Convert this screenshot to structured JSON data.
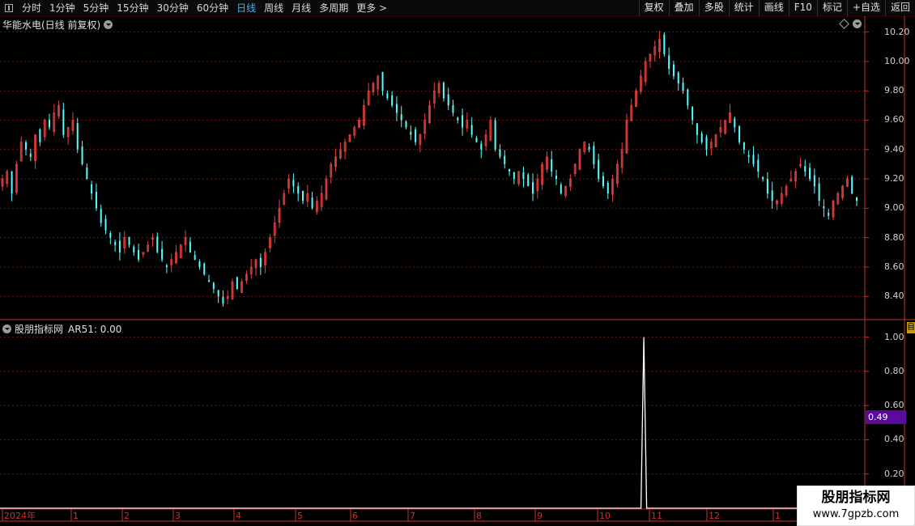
{
  "toolbar": {
    "periods": [
      "分时",
      "1分钟",
      "5分钟",
      "15分钟",
      "30分钟",
      "60分钟",
      "日线",
      "周线",
      "月线",
      "多周期",
      "更多 >"
    ],
    "active_period": "日线",
    "right_buttons": [
      "复权",
      "叠加",
      "多股",
      "统计",
      "画线",
      "F10",
      "标记",
      "+自选",
      "返回"
    ]
  },
  "main_panel": {
    "title": "华能水电(日线 前复权)",
    "y_ticks": [
      "10.20",
      "10.00",
      "9.80",
      "9.60",
      "9.40",
      "9.20",
      "9.00",
      "8.80",
      "8.60",
      "8.40"
    ]
  },
  "sub_panel": {
    "title": "股朋指标网",
    "indicator_label": "AR51: 0.00",
    "y_ticks": [
      "1.00",
      "0.80",
      "0.60",
      "0.40",
      "0.20"
    ],
    "cursor_value": "0.49"
  },
  "x_axis": {
    "labels": [
      "2024年",
      "1",
      "2",
      "3",
      "4",
      "5",
      "6",
      "7",
      "8",
      "9",
      "10",
      "11",
      "12",
      "1"
    ]
  },
  "side_column": {
    "corner": "自"
  },
  "watermark": {
    "line1": "股朋指标网",
    "line2": "www.7gpzb.com"
  },
  "colors": {
    "up": "#e8413c",
    "down": "#54ffff",
    "grid": "#7a1010",
    "active": "#3cb4ff",
    "cursor_box": "#5a0a9c"
  },
  "chart_data": [
    {
      "type": "candlestick",
      "title": "华能水电(日线 前复权)",
      "ylim": [
        8.28,
        10.22
      ],
      "y_ticks": [
        10.2,
        10.0,
        9.8,
        9.6,
        9.4,
        9.2,
        9.0,
        8.8,
        8.6,
        8.4
      ],
      "closes": [
        9.2,
        9.25,
        9.1,
        9.3,
        9.45,
        9.4,
        9.35,
        9.5,
        9.45,
        9.6,
        9.55,
        9.65,
        9.7,
        9.5,
        9.55,
        9.6,
        9.4,
        9.3,
        9.2,
        9.1,
        9.0,
        8.9,
        8.85,
        8.8,
        8.75,
        8.7,
        8.8,
        8.75,
        8.7,
        8.65,
        8.7,
        8.75,
        8.8,
        8.7,
        8.65,
        8.6,
        8.65,
        8.7,
        8.75,
        8.8,
        8.7,
        8.65,
        8.6,
        8.55,
        8.5,
        8.45,
        8.4,
        8.35,
        8.4,
        8.5,
        8.45,
        8.5,
        8.55,
        8.6,
        8.65,
        8.6,
        8.7,
        8.8,
        8.9,
        9.0,
        9.1,
        9.2,
        9.15,
        9.1,
        9.05,
        9.1,
        9.0,
        9.05,
        9.1,
        9.2,
        9.3,
        9.35,
        9.4,
        9.45,
        9.5,
        9.55,
        9.6,
        9.7,
        9.8,
        9.85,
        9.9,
        9.8,
        9.75,
        9.7,
        9.65,
        9.6,
        9.55,
        9.5,
        9.45,
        9.5,
        9.6,
        9.7,
        9.8,
        9.85,
        9.75,
        9.7,
        9.65,
        9.6,
        9.55,
        9.6,
        9.5,
        9.45,
        9.4,
        9.5,
        9.6,
        9.4,
        9.35,
        9.3,
        9.25,
        9.2,
        9.25,
        9.2,
        9.15,
        9.1,
        9.2,
        9.3,
        9.35,
        9.25,
        9.2,
        9.1,
        9.15,
        9.2,
        9.3,
        9.4,
        9.45,
        9.4,
        9.3,
        9.2,
        9.15,
        9.1,
        9.2,
        9.3,
        9.4,
        9.6,
        9.7,
        9.8,
        9.9,
        10.0,
        10.05,
        10.1,
        10.15,
        10.05,
        9.95,
        9.9,
        9.85,
        9.8,
        9.7,
        9.6,
        9.5,
        9.45,
        9.4,
        9.45,
        9.5,
        9.55,
        9.6,
        9.65,
        9.55,
        9.45,
        9.4,
        9.35,
        9.3,
        9.25,
        9.2,
        9.1,
        9.05,
        9.05,
        9.1,
        9.15,
        9.2,
        9.25,
        9.3,
        9.25,
        9.2,
        9.15,
        9.05,
        9.0,
        8.95,
        9.05,
        9.1,
        9.15,
        9.2,
        9.1,
        9.05
      ]
    },
    {
      "type": "line",
      "title": "股朋指标网",
      "series": [
        {
          "name": "AR51",
          "values": [
            0,
            0,
            0,
            0,
            0,
            0,
            0,
            0,
            0,
            0,
            0,
            0,
            0,
            0,
            0,
            0,
            0,
            0,
            0,
            0,
            0,
            0,
            0,
            0,
            0,
            0,
            0,
            0,
            0,
            0,
            0,
            0,
            0,
            0,
            0,
            0,
            0,
            0,
            0,
            0,
            0,
            0,
            0,
            0,
            0,
            0,
            0,
            0,
            0,
            0,
            0,
            0,
            0,
            0,
            0,
            0,
            0,
            0,
            0,
            0,
            0,
            0,
            0,
            0,
            0,
            0,
            0,
            0,
            0,
            0,
            0,
            0,
            0,
            0,
            0,
            0,
            0,
            0,
            0,
            0,
            0,
            0,
            0,
            0,
            0,
            0,
            0,
            0,
            0,
            0,
            0,
            0,
            0,
            0,
            0,
            0,
            0,
            0,
            0,
            0,
            0,
            0,
            0,
            0,
            0,
            0,
            0,
            0,
            0,
            0,
            0,
            0,
            0,
            0,
            0,
            0,
            0,
            0,
            0,
            0,
            0,
            0,
            0,
            0,
            0,
            0,
            0,
            0,
            0,
            0,
            0,
            0,
            0,
            0,
            0,
            0,
            0,
            0,
            0,
            0,
            0,
            0,
            0,
            0,
            0,
            0,
            0,
            0,
            0,
            0,
            0,
            0,
            0,
            0,
            0,
            0,
            0,
            0,
            0,
            0,
            0,
            0,
            0,
            0,
            0,
            0,
            0,
            0,
            0,
            0,
            0,
            0,
            0,
            0,
            0,
            0,
            0,
            0,
            0,
            0,
            0,
            0,
            0,
            0,
            0,
            0,
            0,
            0,
            0,
            0,
            0,
            0,
            0,
            0,
            0,
            0,
            0,
            0,
            0,
            0,
            0,
            0,
            0,
            0,
            0,
            0,
            0,
            0,
            0,
            0,
            0,
            0,
            0,
            0,
            0,
            0,
            0,
            0,
            0,
            0,
            0,
            0,
            0,
            0,
            0,
            0,
            1,
            0,
            0,
            0,
            0,
            0,
            0,
            0,
            0,
            0,
            0,
            0,
            0,
            0,
            0,
            0,
            0,
            0,
            0,
            0,
            0,
            0,
            0,
            0,
            0,
            0,
            0,
            0,
            0,
            0,
            0,
            0,
            0,
            0,
            0,
            0,
            0,
            0,
            0,
            0,
            0,
            0,
            0,
            0,
            0,
            0,
            0,
            0,
            0,
            0,
            0,
            0,
            0,
            0,
            0,
            0,
            0,
            0,
            0,
            0,
            0,
            0,
            0,
            0,
            0,
            0,
            0,
            0,
            0,
            0,
            0,
            0,
            0,
            0,
            0,
            0,
            0,
            0
          ]
        }
      ],
      "ylim": [
        0,
        1.05
      ],
      "y_ticks": [
        1.0,
        0.8,
        0.6,
        0.4,
        0.2
      ]
    }
  ]
}
